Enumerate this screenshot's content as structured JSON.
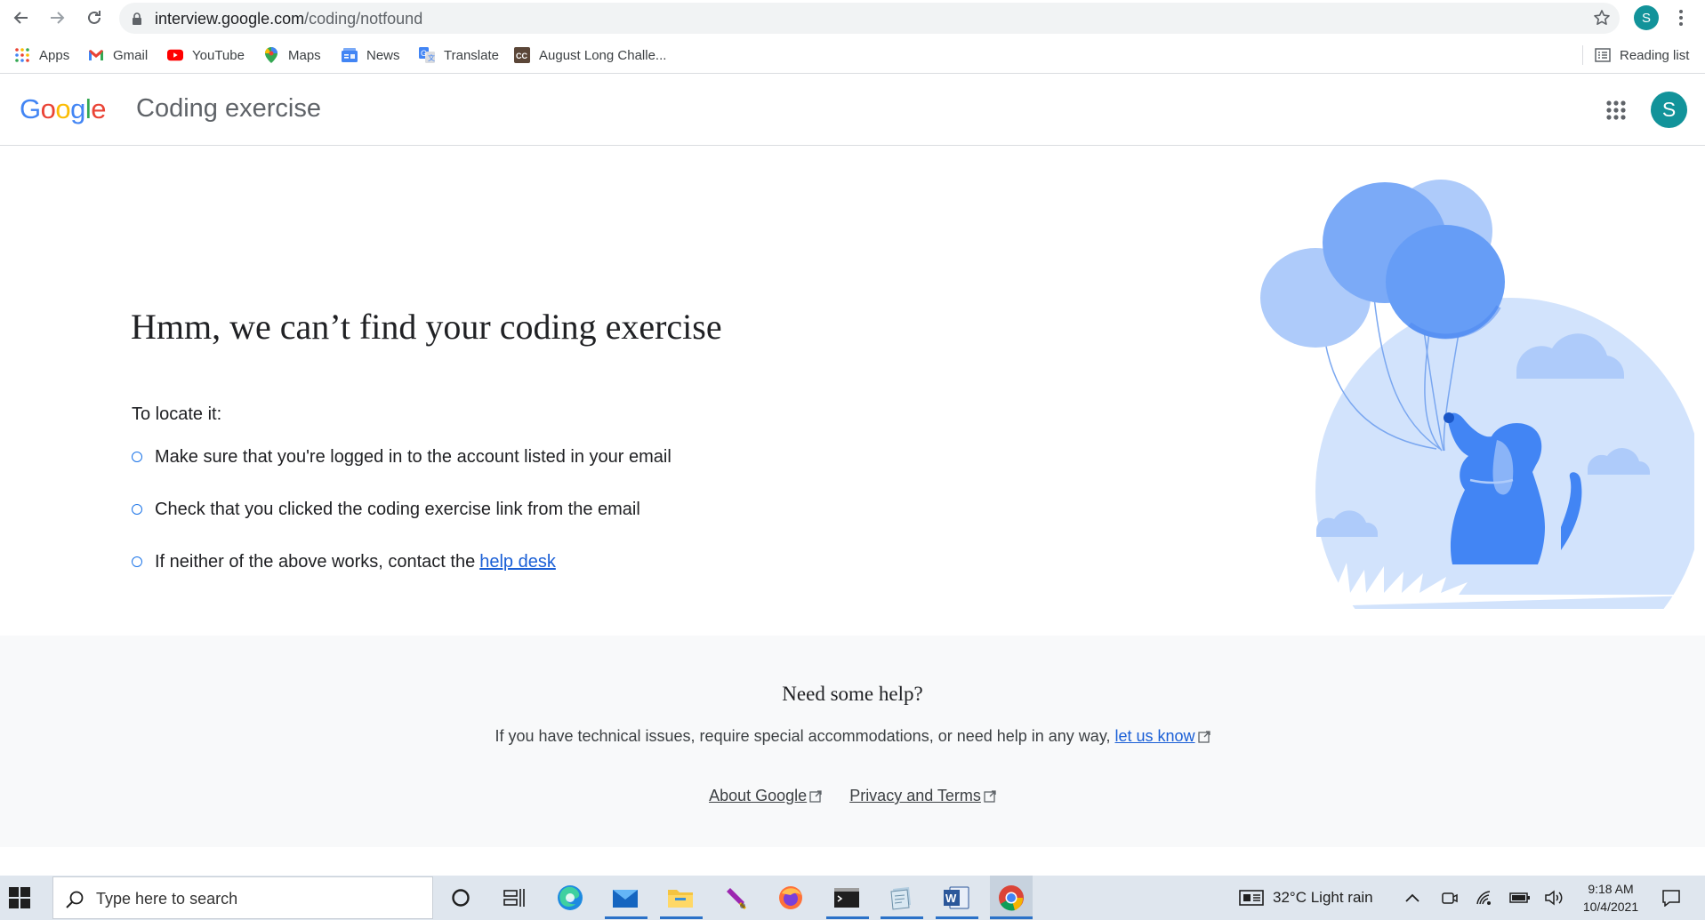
{
  "browser": {
    "url_domain": "interview.google.com",
    "url_path": "/coding/notfound",
    "profile_initial": "S"
  },
  "bookmarks": [
    {
      "label": "Apps",
      "icon": "apps-grid-icon"
    },
    {
      "label": "Gmail",
      "icon": "gmail-icon"
    },
    {
      "label": "YouTube",
      "icon": "youtube-icon"
    },
    {
      "label": "Maps",
      "icon": "maps-icon"
    },
    {
      "label": "News",
      "icon": "news-icon"
    },
    {
      "label": "Translate",
      "icon": "translate-icon"
    },
    {
      "label": "August Long Challe...",
      "icon": "codechef-icon"
    }
  ],
  "reading_list": "Reading list",
  "header": {
    "logo": "Google",
    "title": "Coding exercise",
    "avatar_initial": "S"
  },
  "main": {
    "headline": "Hmm, we can’t find your coding exercise",
    "locate_label": "To locate it:",
    "tips": [
      "Make sure that you're logged in to the account listed in your email",
      "Check that you clicked the coding exercise link from the email",
      "If neither of the above works, contact the"
    ],
    "help_desk_link": "help desk"
  },
  "help": {
    "title": "Need some help?",
    "text": "If you have technical issues, require special accommodations, or need help in any way,",
    "let_us_know": "let us know",
    "about": "About Google",
    "privacy": "Privacy and Terms"
  },
  "taskbar": {
    "search_placeholder": "Type here to search",
    "weather": "32°C  Light rain",
    "time": "9:18 AM",
    "date": "10/4/2021"
  },
  "colors": {
    "link": "#1a5fd6",
    "avatar": "#12939a",
    "balloon": "#6c9ef0",
    "dog": "#3f7be8"
  }
}
